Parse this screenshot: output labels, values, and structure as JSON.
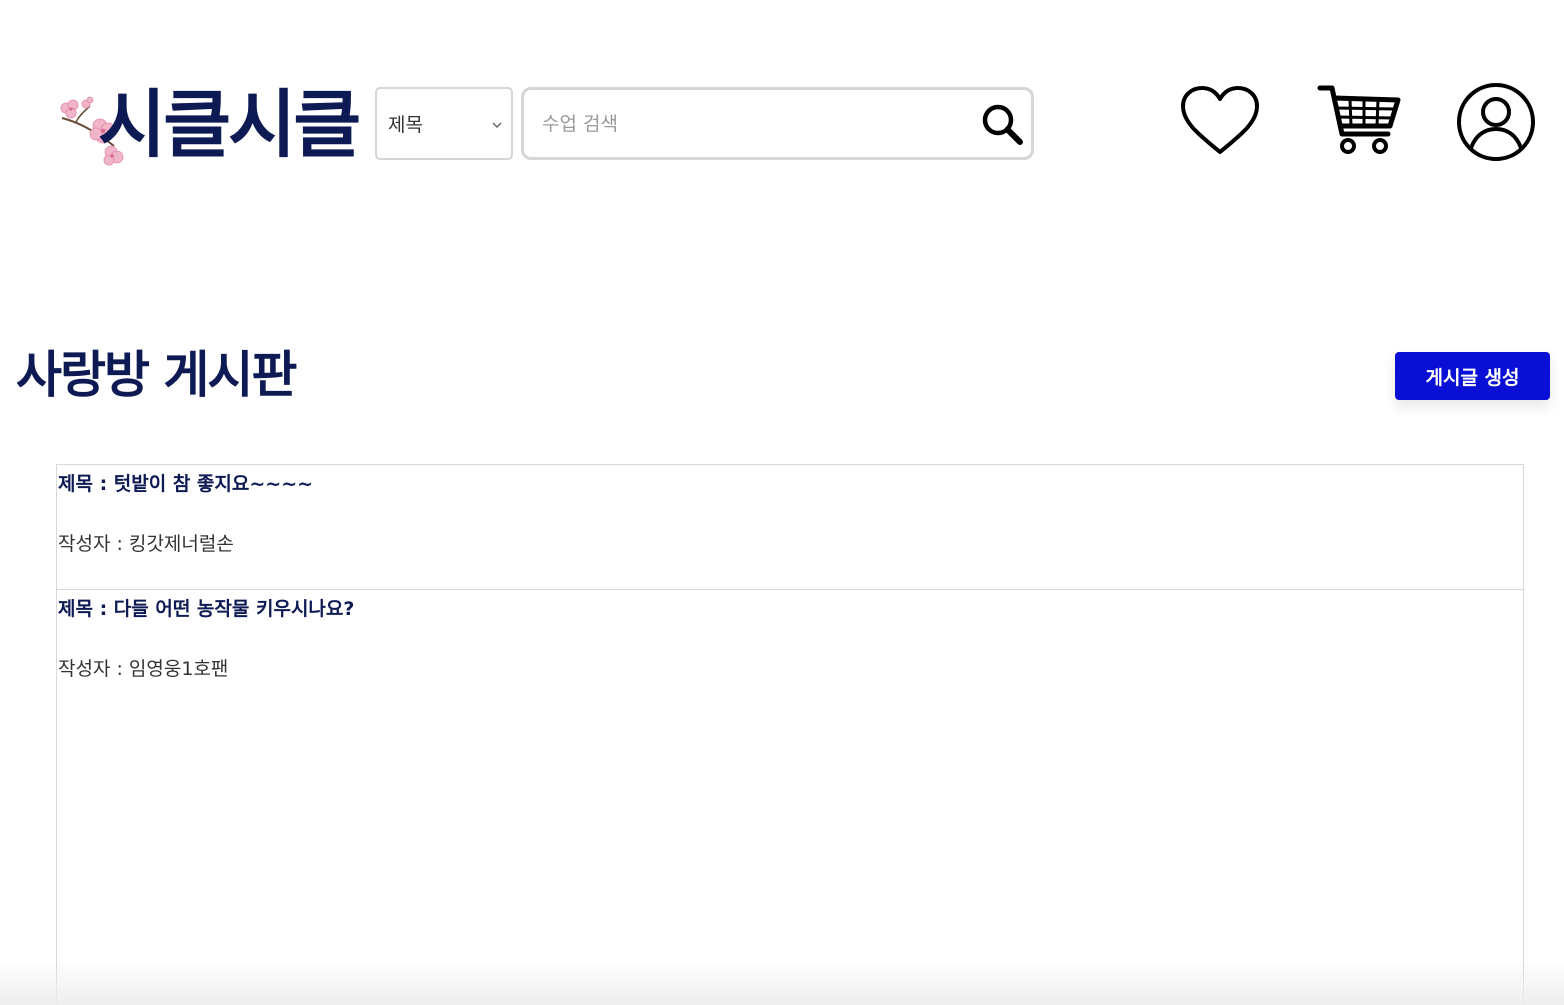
{
  "header": {
    "logo_text": "시클시클",
    "search_type": {
      "selected": "제목"
    },
    "search": {
      "placeholder": "수업 검색",
      "value": ""
    },
    "icons": {
      "search": "search-icon",
      "wishlist": "heart-icon",
      "cart": "cart-icon",
      "profile": "user-icon"
    }
  },
  "board": {
    "title": "사랑방 게시판",
    "create_button": "게시글 생성",
    "posts": [
      {
        "title": "제목 : 텃밭이 참 좋지요~~~~",
        "author": "작성자 : 킹갓제너럴손"
      },
      {
        "title": "제목 : 다들 어떤 농작물 키우시나요?",
        "author": "작성자 : 임영웅1호팬"
      }
    ]
  },
  "colors": {
    "brand_navy": "#0d1a54",
    "button_blue": "#0a0fd6",
    "blossom_pink": "#f1b5c9"
  }
}
